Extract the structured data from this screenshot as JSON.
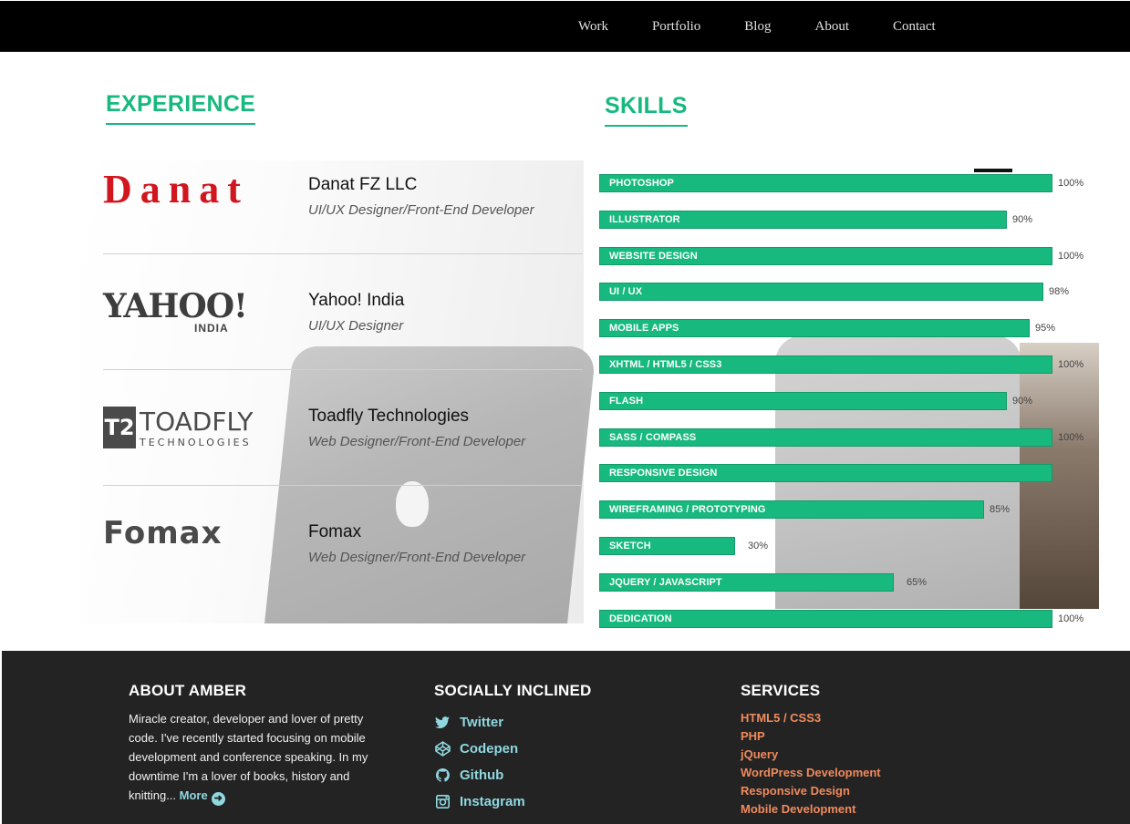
{
  "nav": {
    "items": [
      "Work",
      "Portfolio",
      "Blog",
      "About",
      "Contact"
    ]
  },
  "experience": {
    "title": "EXPERIENCE",
    "items": [
      {
        "company": "Danat FZ LLC",
        "role": "UI/UX Designer/Front-End Developer",
        "logo_text": "Danat"
      },
      {
        "company": "Yahoo! India",
        "role": "UI/UX Designer",
        "logo_text": "YAHOO!",
        "logo_sub": "INDIA"
      },
      {
        "company": "Toadfly Technologies",
        "role": "Web Designer/Front-End Developer",
        "logo_text": "TOADFLY",
        "logo_sub": "TECHNOLOGIES",
        "logo_mark": "T2"
      },
      {
        "company": "Fomax",
        "role": "Web Designer/Front-End Developer",
        "logo_text": "Fomax"
      }
    ]
  },
  "skills": {
    "title": "SKILLS",
    "items": [
      {
        "name": "PHOTOSHOP",
        "percent": 100,
        "label": "100%"
      },
      {
        "name": "ILLUSTRATOR",
        "percent": 90,
        "label": "90%"
      },
      {
        "name": "WEBSITE DESIGN",
        "percent": 100,
        "label": "100%"
      },
      {
        "name": "UI / UX",
        "percent": 98,
        "label": "98%"
      },
      {
        "name": "MOBILE APPS",
        "percent": 95,
        "label": "95%"
      },
      {
        "name": "XHTML / HTML5 / CSS3",
        "percent": 100,
        "label": "100%"
      },
      {
        "name": "FLASH",
        "percent": 90,
        "label": "90%"
      },
      {
        "name": "SASS / COMPASS",
        "percent": 100,
        "label": "100%"
      },
      {
        "name": "RESPONSIVE DESIGN",
        "percent": 100,
        "label": ""
      },
      {
        "name": "WIREFRAMING / PROTOTYPING",
        "percent": 85,
        "label": "85%"
      },
      {
        "name": "SKETCH",
        "percent": 30,
        "label": "30%"
      },
      {
        "name": "JQUERY / JAVASCRIPT",
        "percent": 65,
        "label": "65%"
      },
      {
        "name": "DEDICATION",
        "percent": 100,
        "label": "100%"
      }
    ]
  },
  "footer": {
    "about": {
      "heading": "ABOUT AMBER",
      "text": "Miracle creator, developer and lover of pretty code. I've recently started focusing on mobile development and conference speaking. In my downtime I'm a lover of books, history and knitting...",
      "more": "More"
    },
    "social": {
      "heading": "SOCIALLY INCLINED",
      "items": [
        {
          "label": "Twitter",
          "icon": "twitter-icon"
        },
        {
          "label": "Codepen",
          "icon": "codepen-icon"
        },
        {
          "label": "Github",
          "icon": "github-icon"
        },
        {
          "label": "Instagram",
          "icon": "instagram-icon"
        }
      ]
    },
    "services": {
      "heading": "SERVICES",
      "items": [
        "HTML5 / CSS3",
        "PHP",
        "jQuery",
        "WordPress Development",
        "Responsive Design",
        "Mobile Development"
      ]
    }
  },
  "colors": {
    "accent": "#17b97f",
    "nav_bg": "#000000",
    "footer_bg": "#232323",
    "link": "#8fd8e0",
    "service": "#f08a5d",
    "danat_red": "#d1161f"
  }
}
